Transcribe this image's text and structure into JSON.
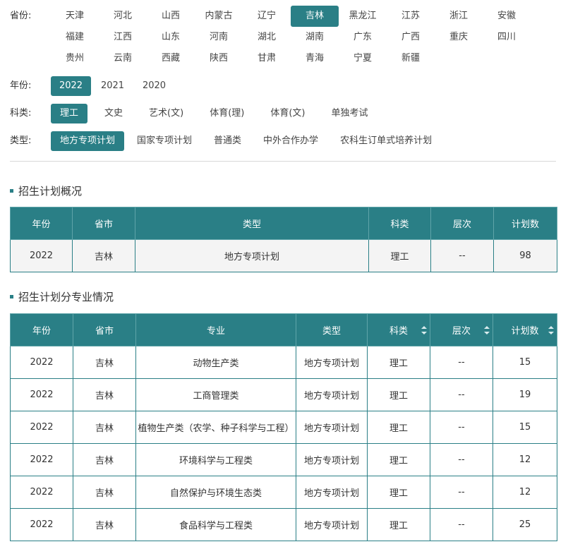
{
  "filters": {
    "province_label": "省份:",
    "provinces": [
      "天津",
      "河北",
      "山西",
      "内蒙古",
      "辽宁",
      "吉林",
      "黑龙江",
      "江苏",
      "浙江",
      "安徽",
      "福建",
      "江西",
      "山东",
      "河南",
      "湖北",
      "湖南",
      "广东",
      "广西",
      "重庆",
      "四川",
      "贵州",
      "云南",
      "西藏",
      "陕西",
      "甘肃",
      "青海",
      "宁夏",
      "新疆"
    ],
    "province_active": "吉林",
    "year_label": "年份:",
    "years": [
      "2022",
      "2021",
      "2020"
    ],
    "year_active": "2022",
    "subject_label": "科类:",
    "subjects": [
      "理工",
      "文史",
      "艺术(文)",
      "体育(理)",
      "体育(文)",
      "单独考试"
    ],
    "subject_active": "理工",
    "type_label": "类型:",
    "types": [
      "地方专项计划",
      "国家专项计划",
      "普通类",
      "中外合作办学",
      "农科生订单式培养计划"
    ],
    "type_active": "地方专项计划"
  },
  "overview": {
    "title": "招生计划概况",
    "headers": [
      "年份",
      "省市",
      "类型",
      "科类",
      "层次",
      "计划数"
    ],
    "rows": [
      [
        "2022",
        "吉林",
        "地方专项计划",
        "理工",
        "--",
        "98"
      ]
    ]
  },
  "majors": {
    "title": "招生计划分专业情况",
    "headers": [
      "年份",
      "省市",
      "专业",
      "类型",
      "科类",
      "层次",
      "计划数"
    ],
    "sortable": [
      false,
      false,
      false,
      false,
      true,
      true,
      true
    ],
    "rows": [
      [
        "2022",
        "吉林",
        "动物生产类",
        "地方专项计划",
        "理工",
        "--",
        "15"
      ],
      [
        "2022",
        "吉林",
        "工商管理类",
        "地方专项计划",
        "理工",
        "--",
        "19"
      ],
      [
        "2022",
        "吉林",
        "植物生产类（农学、种子科学与工程）",
        "地方专项计划",
        "理工",
        "--",
        "15"
      ],
      [
        "2022",
        "吉林",
        "环境科学与工程类",
        "地方专项计划",
        "理工",
        "--",
        "12"
      ],
      [
        "2022",
        "吉林",
        "自然保护与环境生态类",
        "地方专项计划",
        "理工",
        "--",
        "12"
      ],
      [
        "2022",
        "吉林",
        "食品科学与工程类",
        "地方专项计划",
        "理工",
        "--",
        "25"
      ]
    ]
  }
}
